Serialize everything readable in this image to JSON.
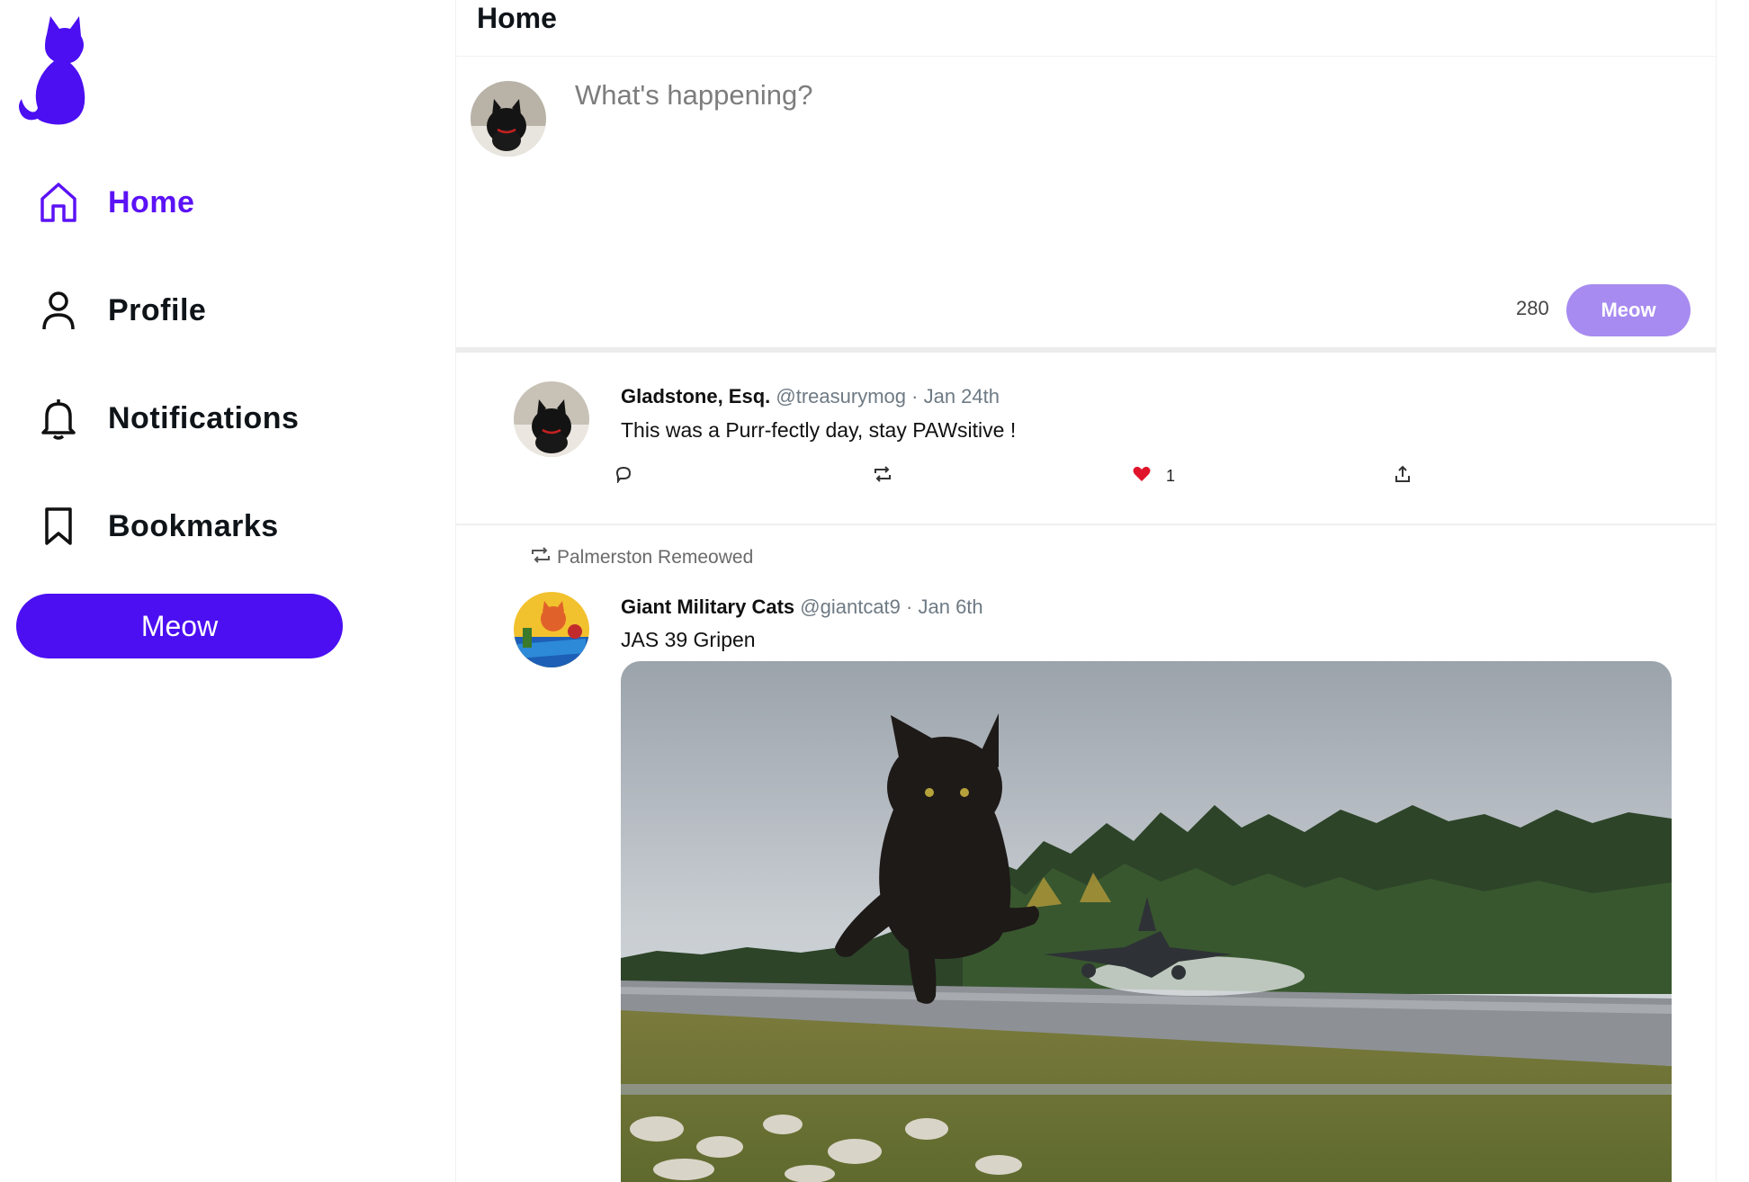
{
  "app": {
    "brand_color": "#4b0ff2",
    "logo_icon": "cat-silhouette-icon"
  },
  "sidebar": {
    "items": [
      {
        "label": "Home",
        "icon": "home-icon",
        "active": true
      },
      {
        "label": "Profile",
        "icon": "user-icon",
        "active": false
      },
      {
        "label": "Notifications",
        "icon": "bell-icon",
        "active": false
      },
      {
        "label": "Bookmarks",
        "icon": "bookmark-icon",
        "active": false
      }
    ],
    "meow_button": "Meow"
  },
  "header": {
    "title": "Home"
  },
  "composer": {
    "placeholder": "What's happening?",
    "value": "",
    "char_count": "280",
    "submit_label": "Meow",
    "submit_color": "#a78bf0"
  },
  "feed": [
    {
      "name": "Gladstone, Esq.",
      "handle": "@treasurymog",
      "separator": "·",
      "date": "Jan 24th",
      "text": "This was a Purr-fectly day, stay PAWsitive !",
      "likes": "1",
      "liked": true
    },
    {
      "repost_note": "Palmerston Remeowed",
      "name": "Giant Military Cats",
      "handle": "@giantcat9",
      "separator": "·",
      "date": "Jan 6th",
      "text": "JAS 39 Gripen",
      "has_image": true
    }
  ]
}
